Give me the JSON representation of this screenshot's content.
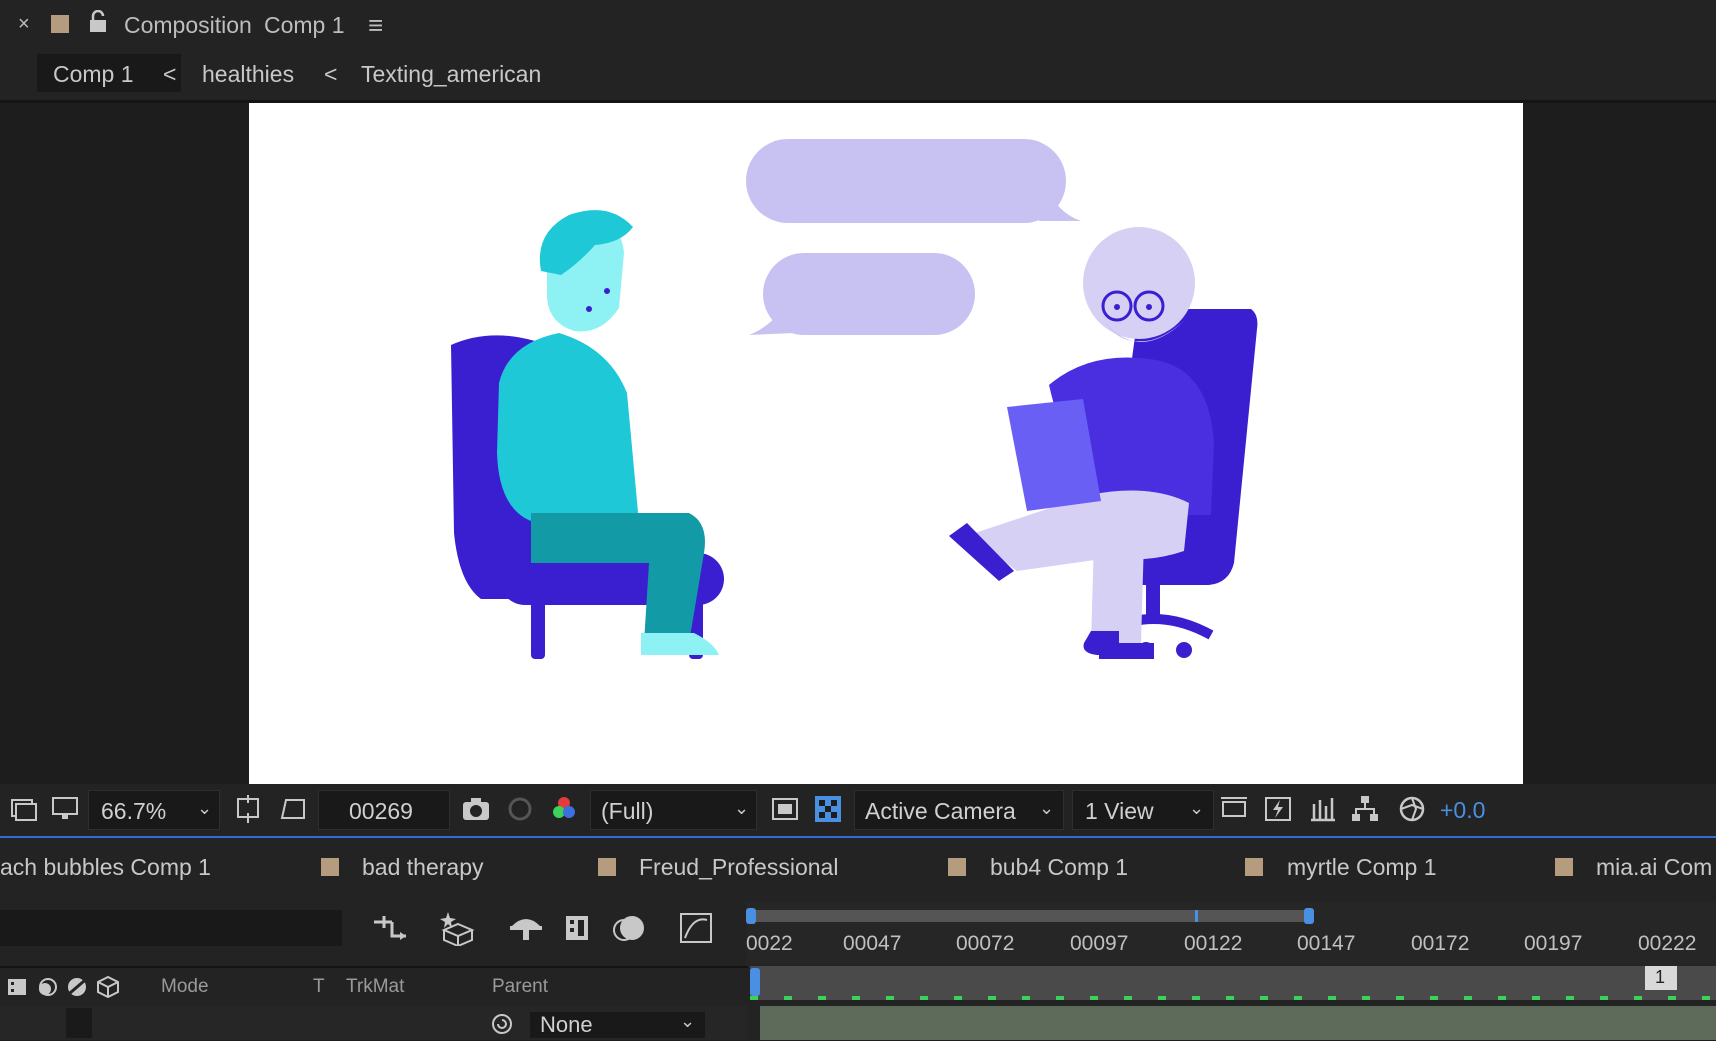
{
  "header": {
    "close_glyph": "×",
    "panel_label": "Composition",
    "comp_name": "Comp 1",
    "menu_glyph": "≡"
  },
  "breadcrumbs": {
    "items": [
      "Comp 1",
      "healthies",
      "Texting_american"
    ],
    "separator": "<"
  },
  "viewer_toolbar": {
    "zoom": "66.7%",
    "timecode": "00269",
    "resolution": "(Full)",
    "camera": "Active Camera",
    "views": "1 View",
    "exposure": "+0.0"
  },
  "comp_tabs": [
    "ach bubbles Comp 1",
    "bad therapy",
    "Freud_Professional",
    "bub4 Comp 1",
    "myrtle Comp 1",
    "mia.ai Com"
  ],
  "timeline": {
    "ruler_ticks": [
      "0022",
      "00047",
      "00072",
      "00097",
      "00122",
      "00147",
      "00172",
      "00197",
      "00222"
    ],
    "columns": {
      "mode": "Mode",
      "t": "T",
      "trkmat": "TrkMat",
      "parent": "Parent"
    },
    "parent_value": "None",
    "marker_label": "1"
  },
  "colors": {
    "accent": "#4a90e2",
    "label_swatch": "#b59c7e",
    "bubble": "#c7c2f2",
    "chair": "#3a1fd1",
    "patient_skin": "#8ef2f5",
    "patient_shirt": "#1ec8d6",
    "therapist_clothes": "#d6d0f5"
  },
  "icons": [
    "lock-icon",
    "menu-icon",
    "snapshot-icon",
    "color-channel-icon",
    "transparency-grid-icon",
    "region-of-interest-icon",
    "timeline-search-icon"
  ]
}
